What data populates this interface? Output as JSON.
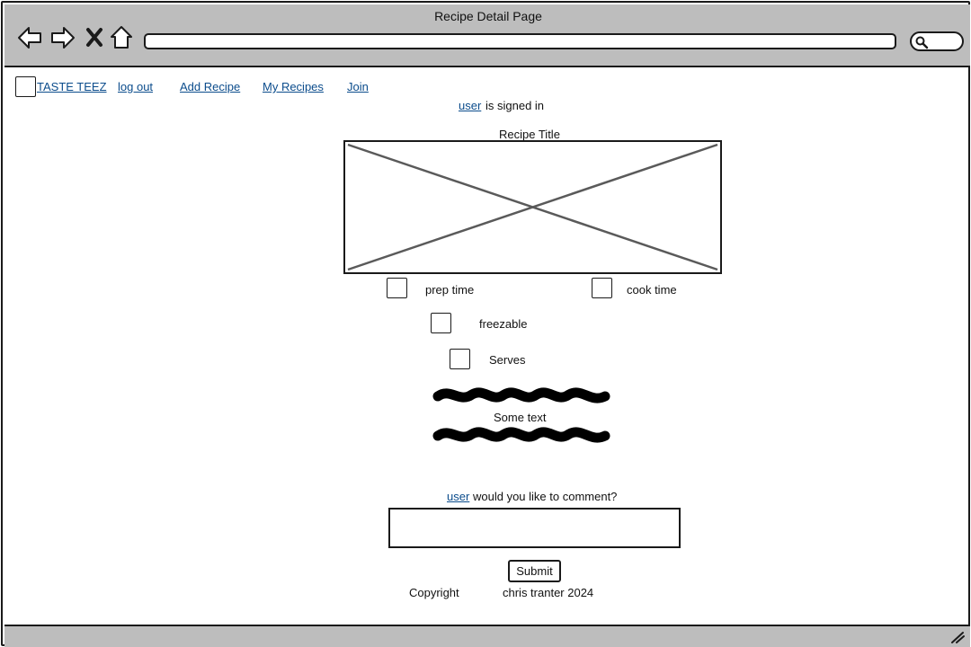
{
  "window": {
    "title": "Recipe Detail Page"
  },
  "browser": {
    "back_icon": "arrow-left-icon",
    "forward_icon": "arrow-right-icon",
    "stop_icon": "close-icon",
    "home_icon": "home-icon",
    "url_value": "",
    "search_icon": "search-icon"
  },
  "nav": {
    "brand": "TASTE TEEZ",
    "items": [
      {
        "label": "log out"
      },
      {
        "label": "Add Recipe"
      },
      {
        "label": "My Recipes"
      },
      {
        "label": "Join"
      }
    ]
  },
  "status": {
    "user_link": "user",
    "text": "is signed in"
  },
  "recipe": {
    "title": "Recipe Title",
    "fields": [
      {
        "label": "prep time"
      },
      {
        "label": "cook time"
      },
      {
        "label": "freezable"
      },
      {
        "label": "Serves"
      }
    ],
    "body_text": "Some text"
  },
  "comment": {
    "user_link": "user",
    "prompt": "would you like to comment?",
    "value": "",
    "submit_label": "Submit"
  },
  "footer": {
    "copyright_label": "Copyright",
    "author": "chris tranter 2024"
  }
}
